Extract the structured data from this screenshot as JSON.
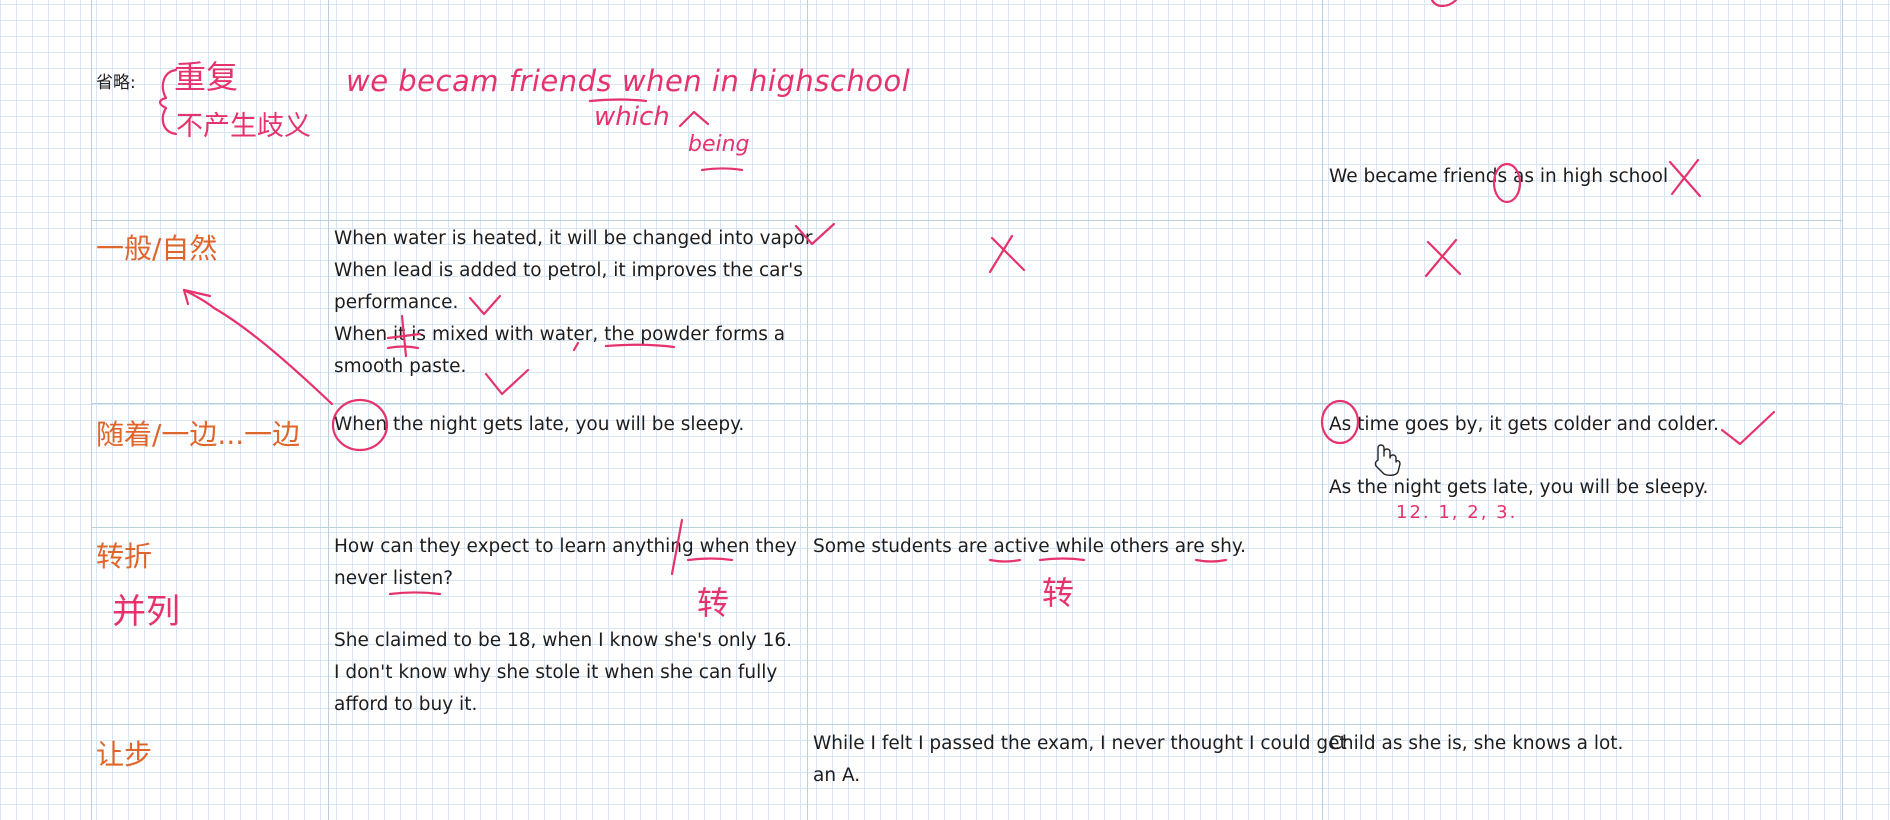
{
  "header_row": {
    "label": "省略:",
    "ink_repeat": "重复",
    "ink_no_ambiguity": "不产生歧义",
    "ink_example": "we becam friends when in highschool",
    "ink_which": "which",
    "ink_being": "being",
    "col4_sentence": "We became friends as in high school"
  },
  "categories": {
    "general": "一般/自然",
    "as_along": "随着/一边...一边",
    "contrast": "转折",
    "contrast_ink": "并列",
    "concession": "让步"
  },
  "rows": {
    "general": {
      "col2": [
        "When water is heated, it will be changed into vapor",
        "When lead is added to petrol, it improves the car's",
        "performance.",
        "When it is mixed with water, the powder forms a",
        "smooth paste."
      ]
    },
    "as_along": {
      "col2": [
        "When the night gets late, you will be sleepy."
      ],
      "col4": [
        "As time goes by,  it gets colder and colder.",
        "As the night gets late, you will be sleepy."
      ],
      "col4_ink": "12. 1, 2, 3."
    },
    "contrast": {
      "col2": [
        "How can they expect to learn anything when they",
        "never listen?",
        "She claimed to be 18, when I know she's only 16.",
        "I don't know why she stole it when she can fully",
        "afford to buy it."
      ],
      "col2_ink": "转",
      "col3": [
        "Some students are active while others are shy."
      ],
      "col3_ink": "转"
    },
    "concession": {
      "col3": [
        "While I felt I passed the exam, I never thought I could get",
        "an A."
      ],
      "col4": [
        "Child as she is, she knows a lot."
      ]
    }
  },
  "ink_colors": {
    "pen": "#e6336d",
    "category": "#e0652b"
  },
  "cursor_icon": "hand-cursor-icon"
}
